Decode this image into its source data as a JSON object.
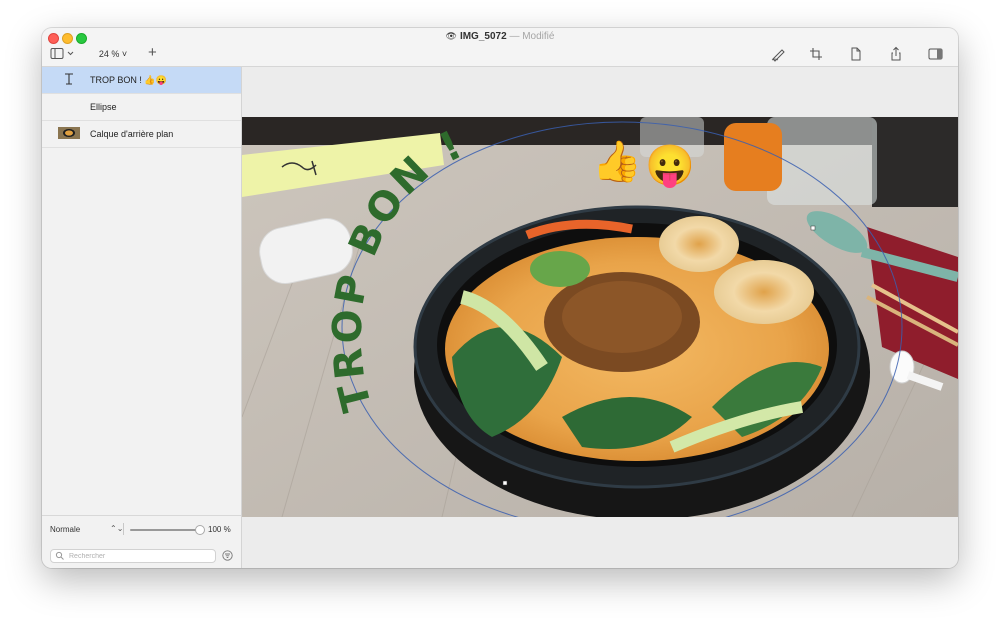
{
  "window": {
    "title_icon": "eye-icon",
    "title": "IMG_5072",
    "title_separator": "—",
    "title_state": "Modifié"
  },
  "toolbar": {
    "zoom_value": "24 %",
    "add_label": "+",
    "icons": [
      "markup-pen-icon",
      "crop-icon",
      "document-icon",
      "share-icon",
      "inspector-icon"
    ]
  },
  "layers": [
    {
      "label": "TROP BON ! 👍😛",
      "type": "text",
      "selected": true,
      "icon": "text-cursor-icon"
    },
    {
      "label": "Ellipse",
      "type": "shape",
      "selected": false
    },
    {
      "label": "Calque d'arrière plan",
      "type": "image",
      "selected": false,
      "icon": "layer-thumbnail"
    }
  ],
  "sidebar_footer": {
    "blend_mode": "Normale",
    "opacity": "100 %",
    "opacity_fraction": 1.0,
    "search_placeholder": "Rechercher"
  },
  "canvas": {
    "overlay_text": "TROP BON !",
    "overlay_emoji_1": "👍",
    "overlay_emoji_2": "😛",
    "overlay_color": "#2e6b2c",
    "selection_color": "#3a5fb0"
  }
}
